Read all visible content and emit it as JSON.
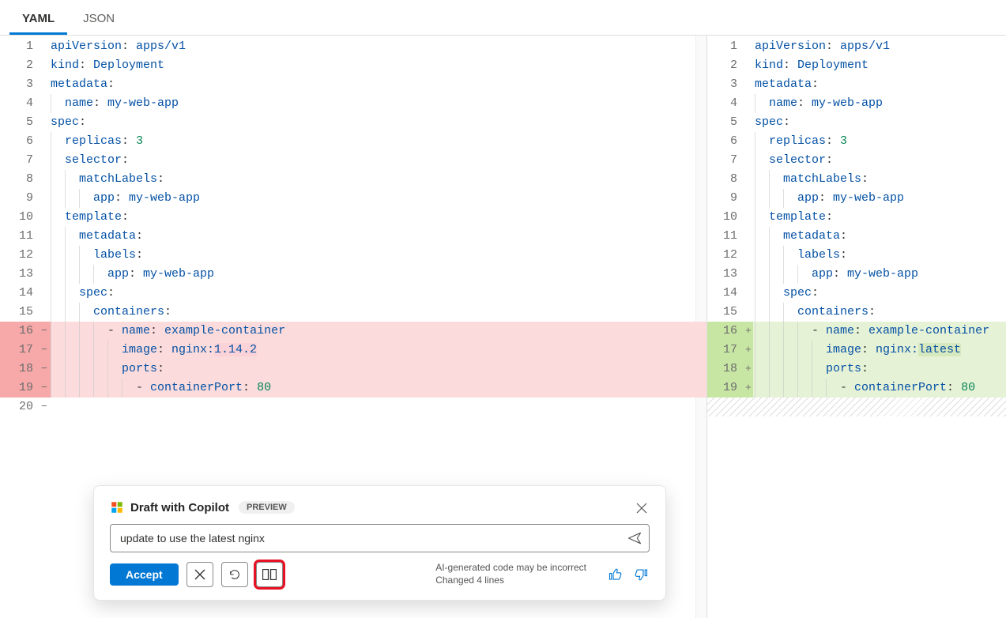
{
  "tabs": {
    "yaml": "YAML",
    "json": "JSON"
  },
  "code": {
    "l1_k": "apiVersion",
    "l1_v": "apps/v1",
    "l2_k": "kind",
    "l2_v": "Deployment",
    "l3_k": "metadata",
    "l4_k": "name",
    "l4_v": "my-web-app",
    "l5_k": "spec",
    "l6_k": "replicas",
    "l6_v": "3",
    "l7_k": "selector",
    "l8_k": "matchLabels",
    "l9_k": "app",
    "l9_v": "my-web-app",
    "l10_k": "template",
    "l11_k": "metadata",
    "l12_k": "labels",
    "l13_k": "app",
    "l13_v": "my-web-app",
    "l14_k": "spec",
    "l15_k": "containers",
    "l16_dash": "- ",
    "l16_k": "name",
    "l16_v": "example-container",
    "l17_k": "image",
    "l17_v_pre": "nginx:",
    "l17_v_old": "1.14.2",
    "l17_v_new": "latest",
    "l18_k": "ports",
    "l19_dash": "- ",
    "l19_k": "containerPort",
    "l19_v": "80"
  },
  "copilot": {
    "title": "Draft with Copilot",
    "preview": "PREVIEW",
    "input": "update to use the latest nginx",
    "accept": "Accept",
    "status1": "AI-generated code may be incorrect",
    "status2": "Changed 4 lines"
  },
  "gutters": {
    "g1": "1",
    "g2": "2",
    "g3": "3",
    "g4": "4",
    "g5": "5",
    "g6": "6",
    "g7": "7",
    "g8": "8",
    "g9": "9",
    "g10": "10",
    "g11": "11",
    "g12": "12",
    "g13": "13",
    "g14": "14",
    "g15": "15",
    "g16": "16",
    "g17": "17",
    "g18": "18",
    "g19": "19",
    "g20": "20",
    "minus": "−",
    "plus": "+"
  }
}
